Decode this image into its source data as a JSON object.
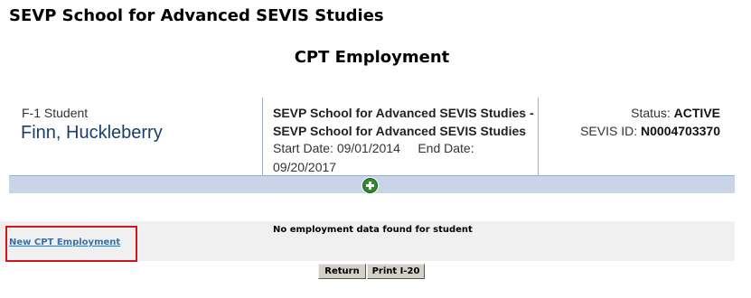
{
  "header": {
    "school_name": "SEVP School for Advanced SEVIS Studies",
    "page_title": "CPT Employment"
  },
  "student": {
    "visa_type": "F-1 Student",
    "name": "Finn, Huckleberry",
    "school_line1": "SEVP School for Advanced SEVIS Studies -",
    "school_line2": "SEVP School for Advanced SEVIS Studies",
    "start_date_label": "Start Date:",
    "start_date": "09/01/2014",
    "end_date_label": "End Date:",
    "end_date": "09/20/2017",
    "status_label": "Status:",
    "status": "ACTIVE",
    "sevis_id_label": "SEVIS ID:",
    "sevis_id": "N0004703370"
  },
  "actions": {
    "add_icon": "plus-circle-icon"
  },
  "employment": {
    "empty_message": "No employment data found for student",
    "new_link": "New CPT Employment"
  },
  "buttons": {
    "return_label": "Return",
    "print_label": "Print I-20"
  },
  "colors": {
    "name_blue": "#183e6b",
    "bar_blue": "#c9d4e6",
    "add_green": "#2e8b2e",
    "link_blue": "#3a6fa8",
    "highlight_red": "#d0181c"
  }
}
